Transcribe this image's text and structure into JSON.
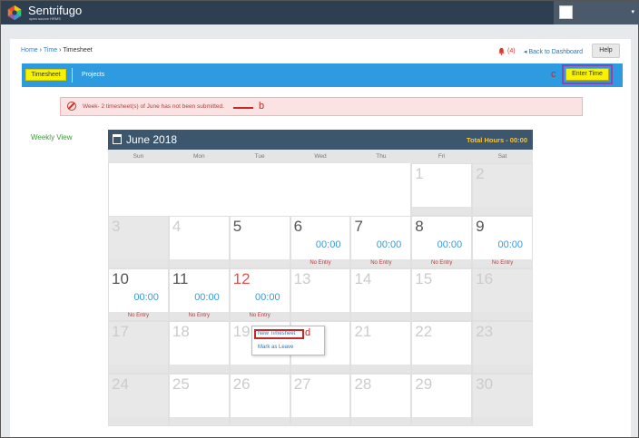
{
  "app": {
    "name": "Sentrifugo",
    "tagline": "open source HRMS"
  },
  "user": {
    "caret": "▾"
  },
  "breadcrumb": {
    "home": "Home",
    "sep1": "›",
    "time": "Time",
    "sep2": "›",
    "current": "Timesheet"
  },
  "header": {
    "bell_icon": "bell-icon",
    "notification_count": "(4)",
    "back_label": "◂ Back to Dashboard",
    "help_label": "Help"
  },
  "toolbar": {
    "tab_timesheet": "Timesheet",
    "tab_projects": "Projects",
    "enter_time_label": "Enter Time",
    "annotation_c": "c"
  },
  "alert": {
    "text": "Week- 2 timesheet(s) of June has not been submitted.",
    "annotation_b": "b",
    "color": "#fbe3e3"
  },
  "sidebar": {
    "weekly_view": "Weekly View"
  },
  "calendar": {
    "title": "June 2018",
    "total_hours": "Total Hours - 00:00",
    "days_of_week": [
      "Sun",
      "Mon",
      "Tue",
      "Wed",
      "Thu",
      "Fri",
      "Sat"
    ],
    "weeks": [
      [
        {
          "day": "",
          "off": false,
          "hours": "",
          "status": ""
        },
        {
          "day": "",
          "off": false,
          "hours": "",
          "status": ""
        },
        {
          "day": "",
          "off": false,
          "hours": "",
          "status": ""
        },
        {
          "day": "",
          "off": false,
          "hours": "",
          "status": ""
        },
        {
          "day": "",
          "off": false,
          "hours": "",
          "status": ""
        },
        {
          "day": "1",
          "off": false,
          "muted": true,
          "hours": "",
          "status": ""
        },
        {
          "day": "2",
          "off": true,
          "hours": "",
          "status": ""
        }
      ],
      [
        {
          "day": "3",
          "off": true,
          "hours": "",
          "status": ""
        },
        {
          "day": "4",
          "off": false,
          "muted": true,
          "hours": "",
          "status": ""
        },
        {
          "day": "5",
          "off": false,
          "hours": "",
          "status": ""
        },
        {
          "day": "6",
          "off": false,
          "hours": "00:00",
          "status": "No Entry"
        },
        {
          "day": "7",
          "off": false,
          "hours": "00:00",
          "status": "No Entry"
        },
        {
          "day": "8",
          "off": false,
          "hours": "00:00",
          "status": "No Entry"
        },
        {
          "day": "9",
          "off": false,
          "hours": "00:00",
          "status": "No Entry"
        }
      ],
      [
        {
          "day": "10",
          "off": false,
          "hours": "00:00",
          "status": "No Entry"
        },
        {
          "day": "11",
          "off": false,
          "hours": "00:00",
          "status": "No Entry"
        },
        {
          "day": "12",
          "off": false,
          "today": true,
          "hours": "00:00",
          "status": "No Entry"
        },
        {
          "day": "13",
          "off": false,
          "muted": true,
          "hours": "",
          "status": ""
        },
        {
          "day": "14",
          "off": false,
          "muted": true,
          "hours": "",
          "status": ""
        },
        {
          "day": "15",
          "off": false,
          "muted": true,
          "hours": "",
          "status": ""
        },
        {
          "day": "16",
          "off": true,
          "hours": "",
          "status": ""
        }
      ],
      [
        {
          "day": "17",
          "off": true,
          "hours": "",
          "status": ""
        },
        {
          "day": "18",
          "off": false,
          "muted": true,
          "hours": "",
          "status": ""
        },
        {
          "day": "19",
          "off": false,
          "muted": true,
          "hours": "",
          "status": ""
        },
        {
          "day": "20",
          "off": false,
          "muted": true,
          "hours": "",
          "status": ""
        },
        {
          "day": "21",
          "off": false,
          "muted": true,
          "hours": "",
          "status": ""
        },
        {
          "day": "22",
          "off": false,
          "muted": true,
          "hours": "",
          "status": ""
        },
        {
          "day": "23",
          "off": true,
          "hours": "",
          "status": ""
        }
      ],
      [
        {
          "day": "24",
          "off": true,
          "hours": "",
          "status": ""
        },
        {
          "day": "25",
          "off": false,
          "muted": true,
          "hours": "",
          "status": ""
        },
        {
          "day": "26",
          "off": false,
          "muted": true,
          "hours": "",
          "status": ""
        },
        {
          "day": "27",
          "off": false,
          "muted": true,
          "hours": "",
          "status": ""
        },
        {
          "day": "28",
          "off": false,
          "muted": true,
          "hours": "",
          "status": ""
        },
        {
          "day": "29",
          "off": false,
          "muted": true,
          "hours": "",
          "status": ""
        },
        {
          "day": "30",
          "off": true,
          "hours": "",
          "status": ""
        }
      ]
    ]
  },
  "context_menu": {
    "new_timesheet": "New Timesheet",
    "mark_as_leave": "Mark as Leave",
    "annotation_d": "d"
  },
  "colors": {
    "topbar": "#2e3f52",
    "toolbar": "#2e9ae0",
    "accent_yellow": "#f7f200",
    "calendar_header": "#3c566d",
    "hours_blue": "#3a99d8",
    "annotation_red": "#c62828"
  }
}
